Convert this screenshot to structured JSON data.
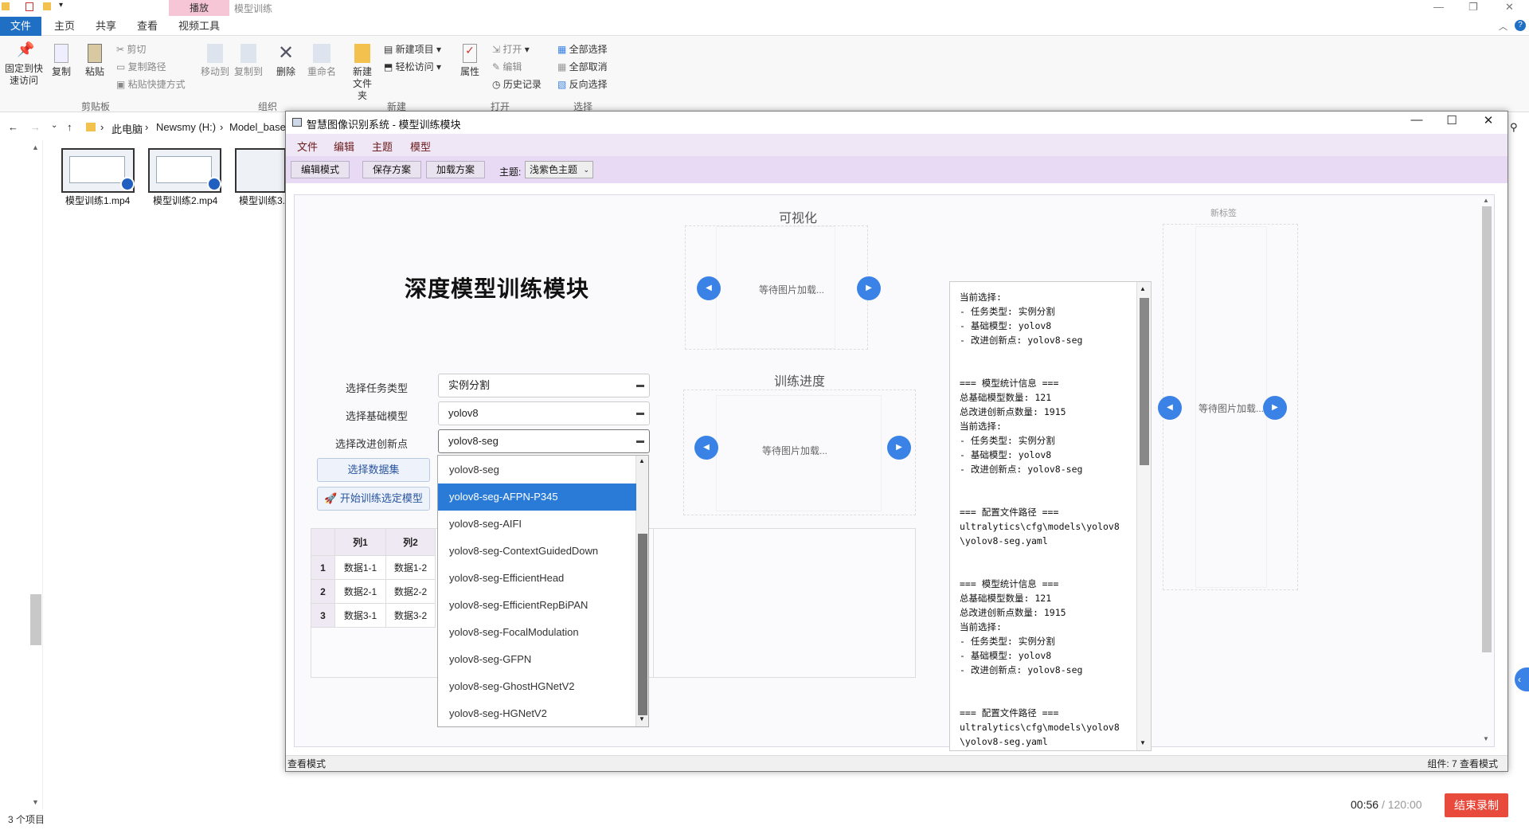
{
  "explorer": {
    "title": "模型训练",
    "play_tab": "播放",
    "tabs": [
      "文件",
      "主页",
      "共享",
      "查看",
      "视频工具"
    ],
    "ribbon": {
      "pin": "固定到快速访问",
      "copy": "复制",
      "paste": "粘贴",
      "cut": "剪切",
      "copy_path": "复制路径",
      "paste_shortcut": "粘贴快捷方式",
      "move_to": "移动到",
      "copy_to": "复制到",
      "delete": "删除",
      "rename": "重命名",
      "new_folder": "新建文件夹",
      "new_item": "新建项目",
      "easy_access": "轻松访问",
      "properties": "属性",
      "open": "打开",
      "edit": "编辑",
      "history": "历史记录",
      "select_all": "全部选择",
      "select_none": "全部取消",
      "invert_select": "反向选择",
      "groups": [
        "剪贴板",
        "组织",
        "新建",
        "打开",
        "选择"
      ]
    },
    "breadcrumb": [
      "此电脑",
      "Newsmy (H:)",
      "Model_base"
    ],
    "files": [
      "模型训练1.mp4",
      "模型训练2.mp4",
      "模型训练3."
    ],
    "status": "3 个项目"
  },
  "app": {
    "title": "智慧图像识别系统 - 模型训练模块",
    "menu": [
      "文件",
      "编辑",
      "主题",
      "模型"
    ],
    "toolbar": {
      "edit_mode": "编辑模式",
      "save_plan": "保存方案",
      "load_plan": "加载方案",
      "theme_label": "主题:",
      "theme_value": "浅紫色主题"
    },
    "heading": "深度模型训练模块",
    "form": {
      "task_label": "选择任务类型",
      "task_value": "实例分割",
      "base_label": "选择基础模型",
      "base_value": "yolov8",
      "improve_label": "选择改进创新点",
      "improve_value": "yolov8-seg",
      "dataset_btn": "选择数据集",
      "train_btn": "开始训练选定模型"
    },
    "table": {
      "headers": [
        "列1",
        "列2"
      ],
      "rows": [
        {
          "idx": "1",
          "c1": "数据1-1",
          "c2": "数据1-2"
        },
        {
          "idx": "2",
          "c1": "数据2-1",
          "c2": "数据2-2"
        },
        {
          "idx": "3",
          "c1": "数据3-1",
          "c2": "数据3-2"
        }
      ]
    },
    "dropdown": {
      "items": [
        "yolov8-seg",
        "yolov8-seg-AFPN-P345",
        "yolov8-seg-AIFI",
        "yolov8-seg-ContextGuidedDown",
        "yolov8-seg-EfficientHead",
        "yolov8-seg-EfficientRepBiPAN",
        "yolov8-seg-FocalModulation",
        "yolov8-seg-GFPN",
        "yolov8-seg-GhostHGNetV2",
        "yolov8-seg-HGNetV2"
      ],
      "selected_index": 1
    },
    "visual": {
      "title": "可视化",
      "waiting": "等待图片加载..."
    },
    "progress": {
      "title": "训练进度",
      "waiting": "等待图片加载..."
    },
    "new_tab": {
      "title": "新标签",
      "waiting": "等待图片加载..."
    },
    "console_text": "当前选择:\n- 任务类型: 实例分割\n- 基础模型: yolov8\n- 改进创新点: yolov8-seg\n\n\n=== 模型统计信息 ===\n总基础模型数量: 121\n总改进创新点数量: 1915\n当前选择:\n- 任务类型: 实例分割\n- 基础模型: yolov8\n- 改进创新点: yolov8-seg\n\n\n=== 配置文件路径 ===\nultralytics\\cfg\\models\\yolov8\n\\yolov8-seg.yaml\n\n\n=== 模型统计信息 ===\n总基础模型数量: 121\n总改进创新点数量: 1915\n当前选择:\n- 任务类型: 实例分割\n- 基础模型: yolov8\n- 改进创新点: yolov8-seg\n\n\n=== 配置文件路径 ===\nultralytics\\cfg\\models\\yolov8\n\\yolov8-seg.yaml",
    "status_left": "查看模式",
    "status_right": "组件: 7  查看模式"
  },
  "recorder": {
    "time": "00:56",
    "total": "/ 120:00",
    "stop_label": "结束录制"
  }
}
